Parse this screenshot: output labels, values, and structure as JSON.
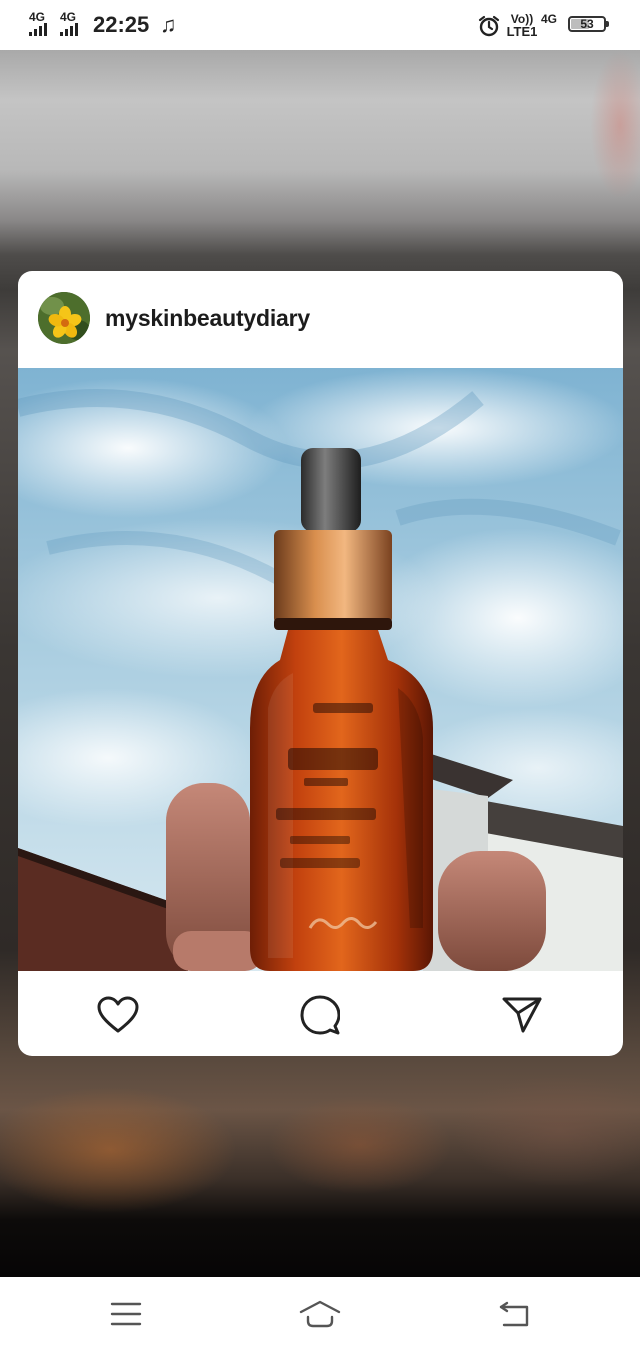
{
  "status_bar": {
    "sim1_network": "4G",
    "sim2_network": "4G",
    "time": "22:25",
    "music_glyph": "♫",
    "volte_line1": "Vo))",
    "volte_line2": "LTE1",
    "mobile_data": "4G",
    "battery_level": "53",
    "icons": [
      "signal-icon",
      "music-note-icon",
      "alarm-icon",
      "battery-icon"
    ]
  },
  "post": {
    "username": "myskinbeautydiary",
    "avatar_icon": "flower-avatar",
    "photo_description_icon": "serum-bottle-photo",
    "actions": {
      "like_icon": "heart-icon",
      "comment_icon": "comment-icon",
      "share_icon": "send-icon"
    }
  },
  "nav_bar": {
    "icons": [
      "menu-icon",
      "home-icon",
      "back-icon"
    ]
  },
  "colors": {
    "card_background": "#ffffff",
    "text_primary": "#1c1c1c",
    "icon_stroke": "#222222",
    "nav_icon": "#555555"
  }
}
